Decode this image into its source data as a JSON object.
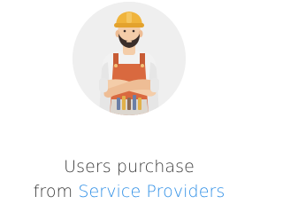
{
  "illustration": {
    "icon": "construction-worker-icon",
    "colors": {
      "background": "#efefef",
      "helmet": "#f0b43c",
      "overalls": "#d9693f",
      "shirt": "#f2f2f2",
      "skin": "#f4cda9",
      "hair": "#3a2e2a",
      "tool_belt": "#dcd7d0"
    }
  },
  "caption": {
    "line1": "Users purchase",
    "line2_prefix": "from ",
    "link_text": "Service Providers",
    "text_color": "#3a3a3a",
    "link_color": "#2f8fe6"
  }
}
